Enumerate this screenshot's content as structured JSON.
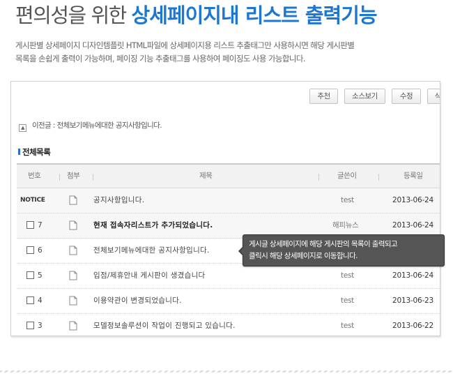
{
  "headline": {
    "light": "편의성을 위한 ",
    "strong": "상세페이지내 리스트 출력기능"
  },
  "description": [
    "게시판별 상세페이지 디자인템플릿 HTML파일에 상세페이지용 리스트 추출태그만 사용하시면 해당 게시판별",
    "목록을 손쉽게 출력이 가능하며, 페이징 기능 추출태그를 사용하여 페이징도 사용 가능합니다."
  ],
  "toolbar": [
    "추천",
    "소스보기",
    "수정",
    "삭제"
  ],
  "prev_post": {
    "icon": "▲",
    "label": "이전글 : 전체보기메뉴에대한 공지사항입니다."
  },
  "section_title": "전체목록",
  "columns": {
    "no": "번호",
    "attach": "첨부",
    "title": "제목",
    "writer": "글쓴이",
    "date": "등록일"
  },
  "rows": [
    {
      "no": "NOTICE",
      "notice": true,
      "title": "공지사항입니다.",
      "writer": "test",
      "date": "2013-06-24",
      "bold": false
    },
    {
      "no": "7",
      "notice": false,
      "title": "현재 접속자리스트가 추가되었습니다.",
      "writer": "해피뉴스",
      "date": "2013-06-24",
      "bold": true
    },
    {
      "no": "6",
      "notice": false,
      "title": "전체보기메뉴에대한 공지사항입니다.",
      "writer": "",
      "date": "",
      "bold": false
    },
    {
      "no": "5",
      "notice": false,
      "title": "입점/제휴안내 게시판이 생겼습니다",
      "writer": "test",
      "date": "2013-06-24",
      "bold": false
    },
    {
      "no": "4",
      "notice": false,
      "title": "이용약관이 변경되었습니다.",
      "writer": "test",
      "date": "2013-06-23",
      "bold": false
    },
    {
      "no": "3",
      "notice": false,
      "title": "모델정보솔루션이 작업이 진행되고 있습니다.",
      "writer": "test",
      "date": "2013-06-22",
      "bold": false
    }
  ],
  "tooltip": [
    "게시글 상세페이지에 해당 게시판의 목록이 출력되고",
    "클릭시 해당 상세페이지로 이동합니다."
  ],
  "colors": {
    "accent": "#1d77d1",
    "tooltip_bg": "#555555"
  }
}
